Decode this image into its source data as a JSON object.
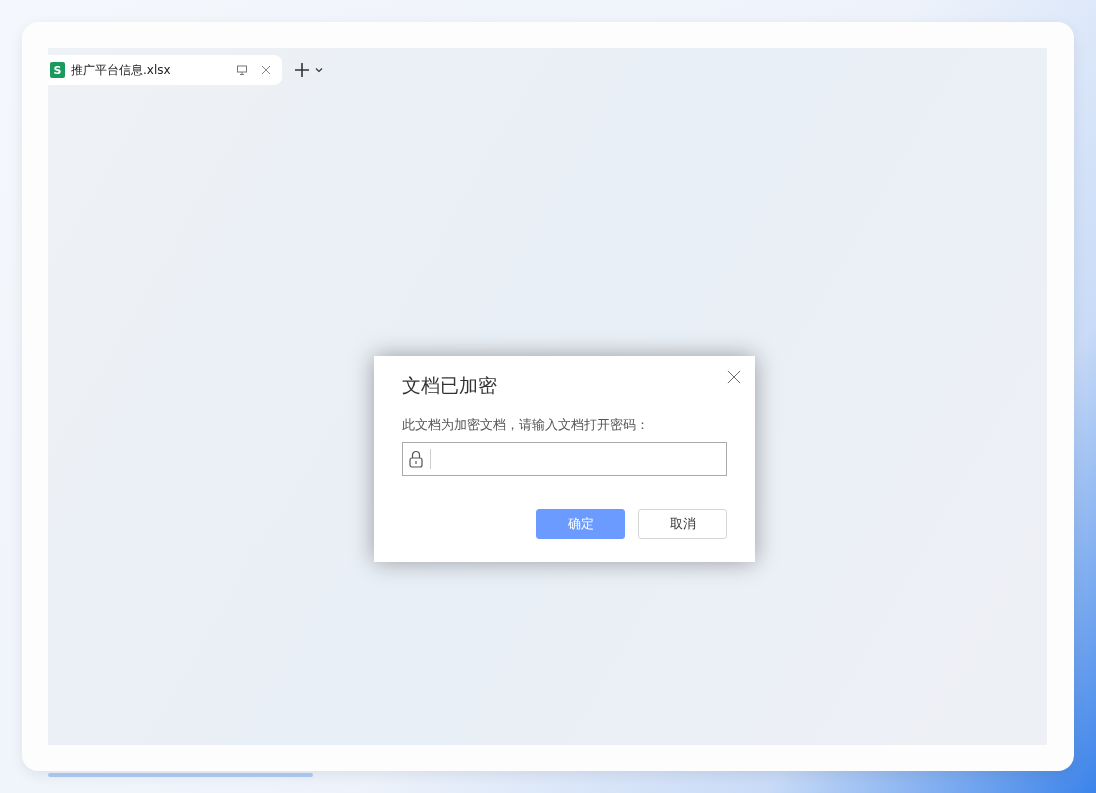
{
  "tabs": [
    {
      "icon_letter": "S",
      "label": "推广平台信息.xlsx",
      "selected": true
    }
  ],
  "dialog": {
    "title": "文档已加密",
    "message": "此文档为加密文档，请输入文档打开密码：",
    "buttons": [
      {
        "label": "确定",
        "kind": "primary"
      },
      {
        "label": "取消",
        "kind": "secondary"
      }
    ]
  }
}
